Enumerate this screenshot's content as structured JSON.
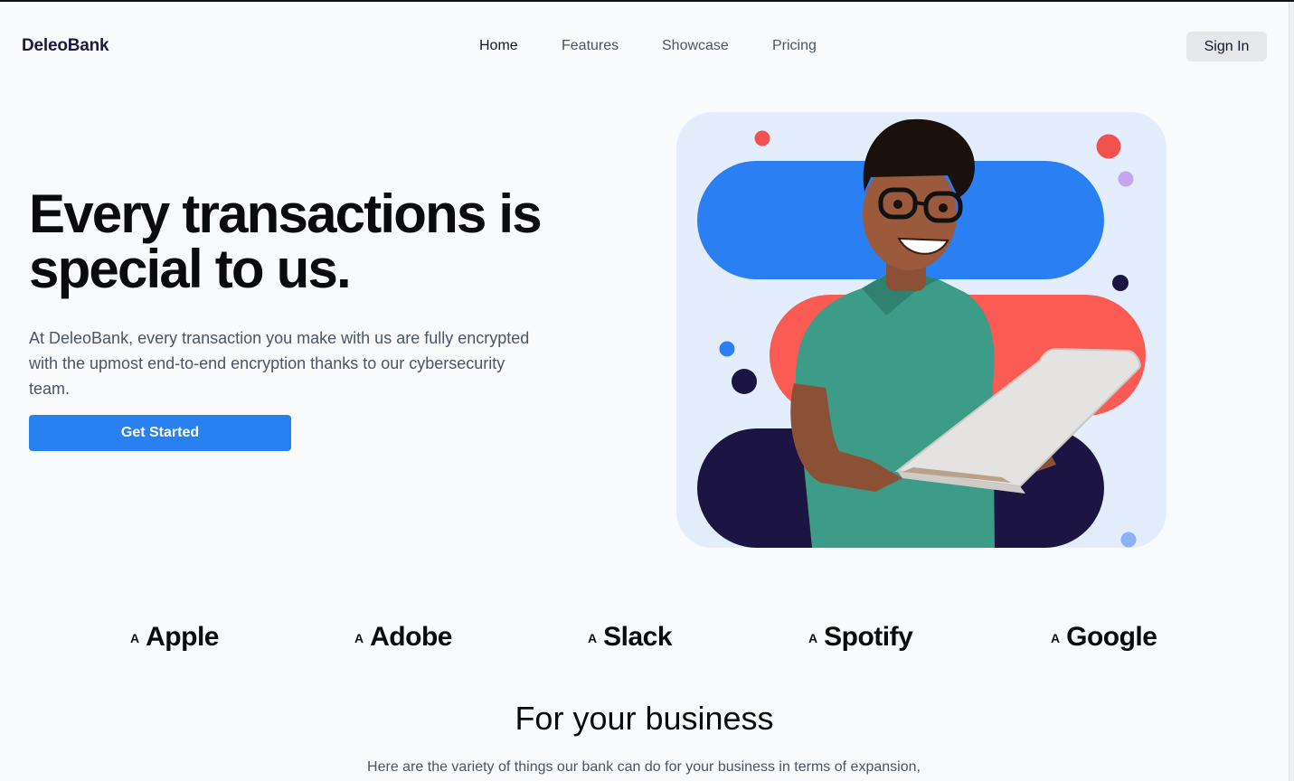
{
  "header": {
    "brand": "DeleoBank",
    "nav": [
      "Home",
      "Features",
      "Showcase",
      "Pricing"
    ],
    "active_nav": "Home",
    "signin_label": "Sign In"
  },
  "hero": {
    "title": "Every transactions is special to us.",
    "text": "At DeleoBank, every transaction you make with us are fully encrypted with the upmost end-to-end encryption thanks to our cybersecurity team.",
    "cta_label": "Get Started",
    "accent_color": "#2980f0"
  },
  "partners": {
    "icon": "A",
    "logos": [
      "Apple",
      "Adobe",
      "Slack",
      "Spotify",
      "Google"
    ]
  },
  "business": {
    "title": "For your business",
    "text": "Here are the variety of things our bank can do for your business in terms of expansion, collaboration, financial assistance and others."
  },
  "colors": {
    "blue": "#2980f0",
    "coral": "#fa5b52",
    "navy": "#1c1544",
    "panel": "#e3edfc"
  }
}
